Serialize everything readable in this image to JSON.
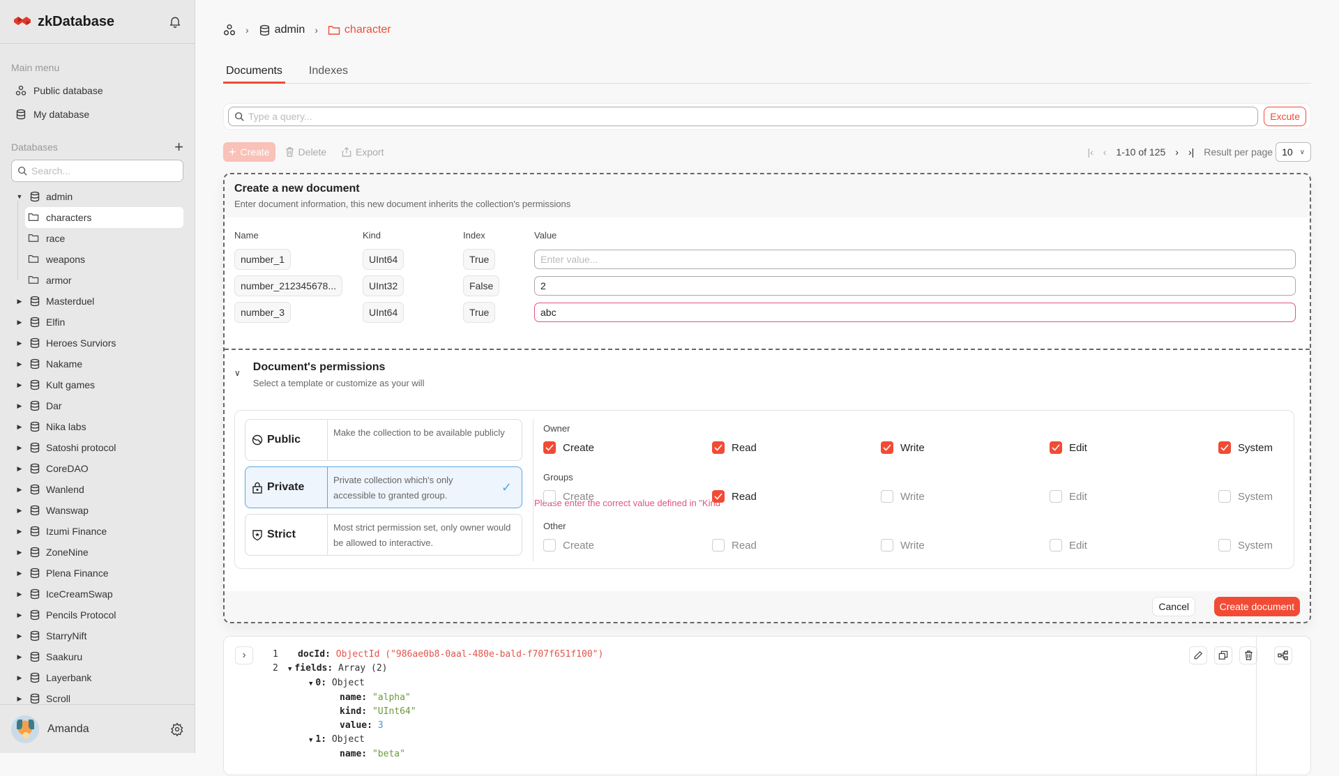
{
  "app": {
    "name": "zkDatabase"
  },
  "sidebar": {
    "main_menu_label": "Main menu",
    "menu": [
      {
        "label": "Public database",
        "icon": "public-database-icon"
      },
      {
        "label": "My database",
        "icon": "database-icon"
      }
    ],
    "databases_label": "Databases",
    "search_placeholder": "Search...",
    "tree": {
      "expanded": {
        "label": "admin",
        "children": [
          "characters",
          "race",
          "weapons",
          "armor"
        ],
        "active_child": "characters"
      },
      "collapsed": [
        "Masterduel",
        "Elfin",
        "Heroes Surviors",
        "Nakame",
        "Kult games",
        "Dar",
        "Nika labs",
        "Satoshi protocol",
        "CoreDAO",
        "Wanlend",
        "Wanswap",
        "Izumi Finance",
        "ZoneNine",
        "Plena Finance",
        "IceCreamSwap",
        "Pencils Protocol",
        "StarryNift",
        "Saakuru",
        "Layerbank",
        "Scroll"
      ]
    },
    "user": {
      "name": "Amanda"
    }
  },
  "breadcrumb": {
    "db": "admin",
    "collection": "character"
  },
  "tabs": [
    {
      "label": "Documents",
      "active": true
    },
    {
      "label": "Indexes",
      "active": false
    }
  ],
  "query": {
    "placeholder": "Type a query...",
    "execute_label": "Excute"
  },
  "toolbar": {
    "create": "Create",
    "delete": "Delete",
    "export": "Export"
  },
  "pagination": {
    "range": "1-10 of 125",
    "per_page_label": "Result per page",
    "per_page": "10"
  },
  "create_panel": {
    "title": "Create a new document",
    "subtitle": "Enter document information, this new document inherits the collection's permissions",
    "columns": {
      "name": "Name",
      "kind": "Kind",
      "index": "Index",
      "value": "Value"
    },
    "rows": [
      {
        "name": "number_1",
        "kind": "UInt64",
        "index": "True",
        "value": "",
        "placeholder": "Enter value..."
      },
      {
        "name": "number_212345678...",
        "kind": "UInt32",
        "index": "False",
        "value": "2",
        "placeholder": ""
      },
      {
        "name": "number_3",
        "kind": "UInt64",
        "index": "True",
        "value": "abc",
        "placeholder": "",
        "error": "Please enter the correct value defined in \"Kind\""
      }
    ],
    "permissions": {
      "title": "Document's permissions",
      "subtitle": "Select a template or customize as your will",
      "templates": [
        {
          "name": "Public",
          "desc": "Make the collection to be available publicly",
          "selected": false
        },
        {
          "name": "Private",
          "desc": "Private collection which's only accessible to granted group.",
          "selected": true
        },
        {
          "name": "Strict",
          "desc": "Most strict permission set, only owner would be allowed to interactive.",
          "selected": false
        }
      ],
      "groups": [
        {
          "label": "Owner",
          "perms": [
            {
              "label": "Create",
              "checked": true
            },
            {
              "label": "Read",
              "checked": true
            },
            {
              "label": "Write",
              "checked": true
            },
            {
              "label": "Edit",
              "checked": true
            },
            {
              "label": "System",
              "checked": true
            }
          ]
        },
        {
          "label": "Groups",
          "perms": [
            {
              "label": "Create",
              "checked": false
            },
            {
              "label": "Read",
              "checked": true
            },
            {
              "label": "Write",
              "checked": false
            },
            {
              "label": "Edit",
              "checked": false
            },
            {
              "label": "System",
              "checked": false
            }
          ]
        },
        {
          "label": "Other",
          "perms": [
            {
              "label": "Create",
              "checked": false
            },
            {
              "label": "Read",
              "checked": false
            },
            {
              "label": "Write",
              "checked": false
            },
            {
              "label": "Edit",
              "checked": false
            },
            {
              "label": "System",
              "checked": false
            }
          ]
        }
      ]
    },
    "cancel_label": "Cancel",
    "create_label": "Create document"
  },
  "document": {
    "lines": [
      {
        "no": "1",
        "key": "docId:",
        "value": "ObjectId (\"986ae0b8-0aal-480e-bald-f707f651f100\")",
        "type": "r",
        "indent": 0,
        "caret": false
      },
      {
        "no": "2",
        "key": "fields:",
        "value": "Array (2)",
        "type": "t",
        "indent": 0,
        "caret": true
      },
      {
        "no": "",
        "key": "0:",
        "value": "Object",
        "type": "t",
        "indent": 1,
        "caret": true
      },
      {
        "no": "",
        "key": "name:",
        "value": "\"alpha\"",
        "type": "s",
        "indent": 2,
        "caret": false
      },
      {
        "no": "",
        "key": "kind:",
        "value": "\"UInt64\"",
        "type": "s",
        "indent": 2,
        "caret": false
      },
      {
        "no": "",
        "key": "value:",
        "value": "3",
        "type": "n",
        "indent": 2,
        "caret": false
      },
      {
        "no": "",
        "key": "1:",
        "value": "Object",
        "type": "t",
        "indent": 1,
        "caret": true
      },
      {
        "no": "",
        "key": "name:",
        "value": "\"beta\"",
        "type": "s",
        "indent": 2,
        "caret": false
      }
    ]
  },
  "colors": {
    "accent": "#f24b35",
    "error": "#e2547f",
    "selected": "#5aa7e3"
  }
}
